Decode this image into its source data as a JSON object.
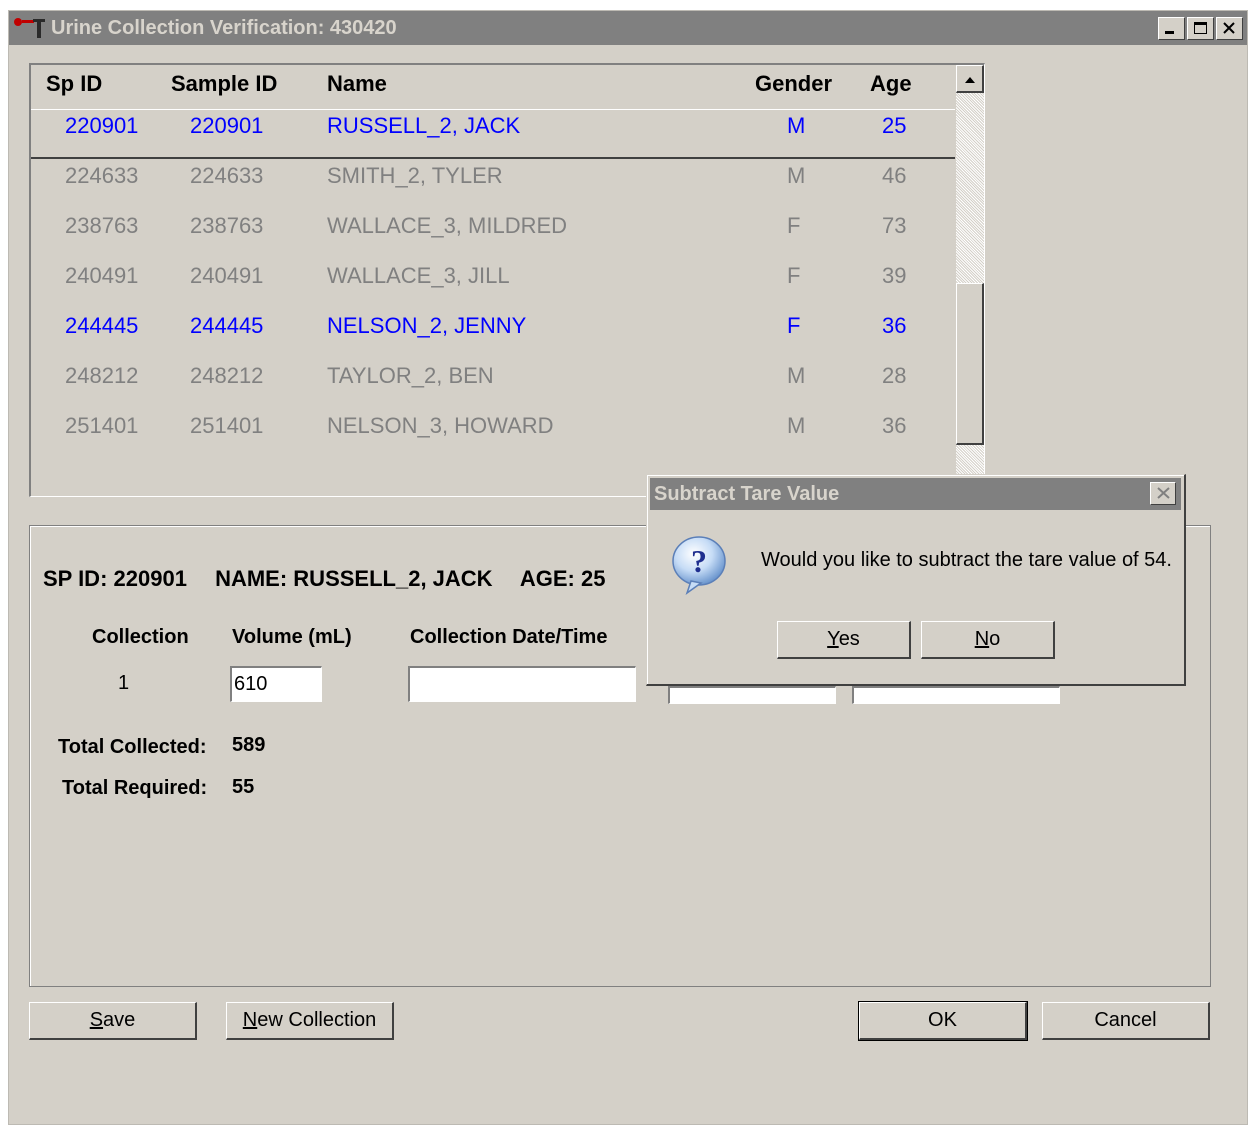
{
  "window": {
    "title": "Urine Collection Verification: 430420",
    "icon": "app-icon",
    "controls": [
      "minimize-icon",
      "maximize-icon",
      "close-icon"
    ]
  },
  "list": {
    "headers": {
      "sp_id": "Sp ID",
      "sample_id": "Sample ID",
      "name": "Name",
      "gender": "Gender",
      "age": "Age"
    },
    "rows": [
      {
        "sp_id": "220901",
        "sample_id": "220901",
        "name": "RUSSELL_2, JACK",
        "gender": "M",
        "age": "25",
        "color": "#0000ff"
      },
      {
        "sp_id": "224633",
        "sample_id": "224633",
        "name": "SMITH_2, TYLER",
        "gender": "M",
        "age": "46",
        "color": "#808080"
      },
      {
        "sp_id": "238763",
        "sample_id": "238763",
        "name": "WALLACE_3, MILDRED",
        "gender": "F",
        "age": "73",
        "color": "#808080"
      },
      {
        "sp_id": "240491",
        "sample_id": "240491",
        "name": "WALLACE_3, JILL",
        "gender": "F",
        "age": "39",
        "color": "#808080"
      },
      {
        "sp_id": "244445",
        "sample_id": "244445",
        "name": "NELSON_2, JENNY",
        "gender": "F",
        "age": "36",
        "color": "#0000ff"
      },
      {
        "sp_id": "248212",
        "sample_id": "248212",
        "name": "TAYLOR_2, BEN",
        "gender": "M",
        "age": "28",
        "color": "#808080"
      },
      {
        "sp_id": "251401",
        "sample_id": "251401",
        "name": "NELSON_3, HOWARD",
        "gender": "M",
        "age": "36",
        "color": "#808080"
      }
    ]
  },
  "detail": {
    "sp_id_label": "SP ID:",
    "sp_id_value": "220901",
    "name_label": "NAME:",
    "name_value": "RUSSELL_2, JACK",
    "age_label": "AGE:",
    "age_value": "25",
    "col_collection": "Collection",
    "col_volume": "Volume (mL)",
    "col_datetime": "Collection Date/Time",
    "collection_number": "1",
    "volume_value": "610",
    "datetime_value": "",
    "total_collected_label": "Total Collected:",
    "total_collected_value": "589",
    "total_required_label": "Total Required:",
    "total_required_value": "55"
  },
  "buttons": {
    "save": {
      "first": "S",
      "rest": "ave"
    },
    "new_collection": {
      "first": "N",
      "rest": "ew Collection"
    },
    "ok": "OK",
    "cancel": "Cancel"
  },
  "dialog": {
    "title": "Subtract Tare Value",
    "message": "Would you like to subtract the tare value of 54.",
    "icon": "question-icon",
    "yes": {
      "first": "Y",
      "rest": "es"
    },
    "no": {
      "first": "N",
      "rest": "o"
    }
  },
  "colors": {
    "window_bg": "#d4d0c8",
    "titlebar_inactive": "#808080",
    "highlight_row": "#0000ff",
    "dim_row": "#808080"
  }
}
